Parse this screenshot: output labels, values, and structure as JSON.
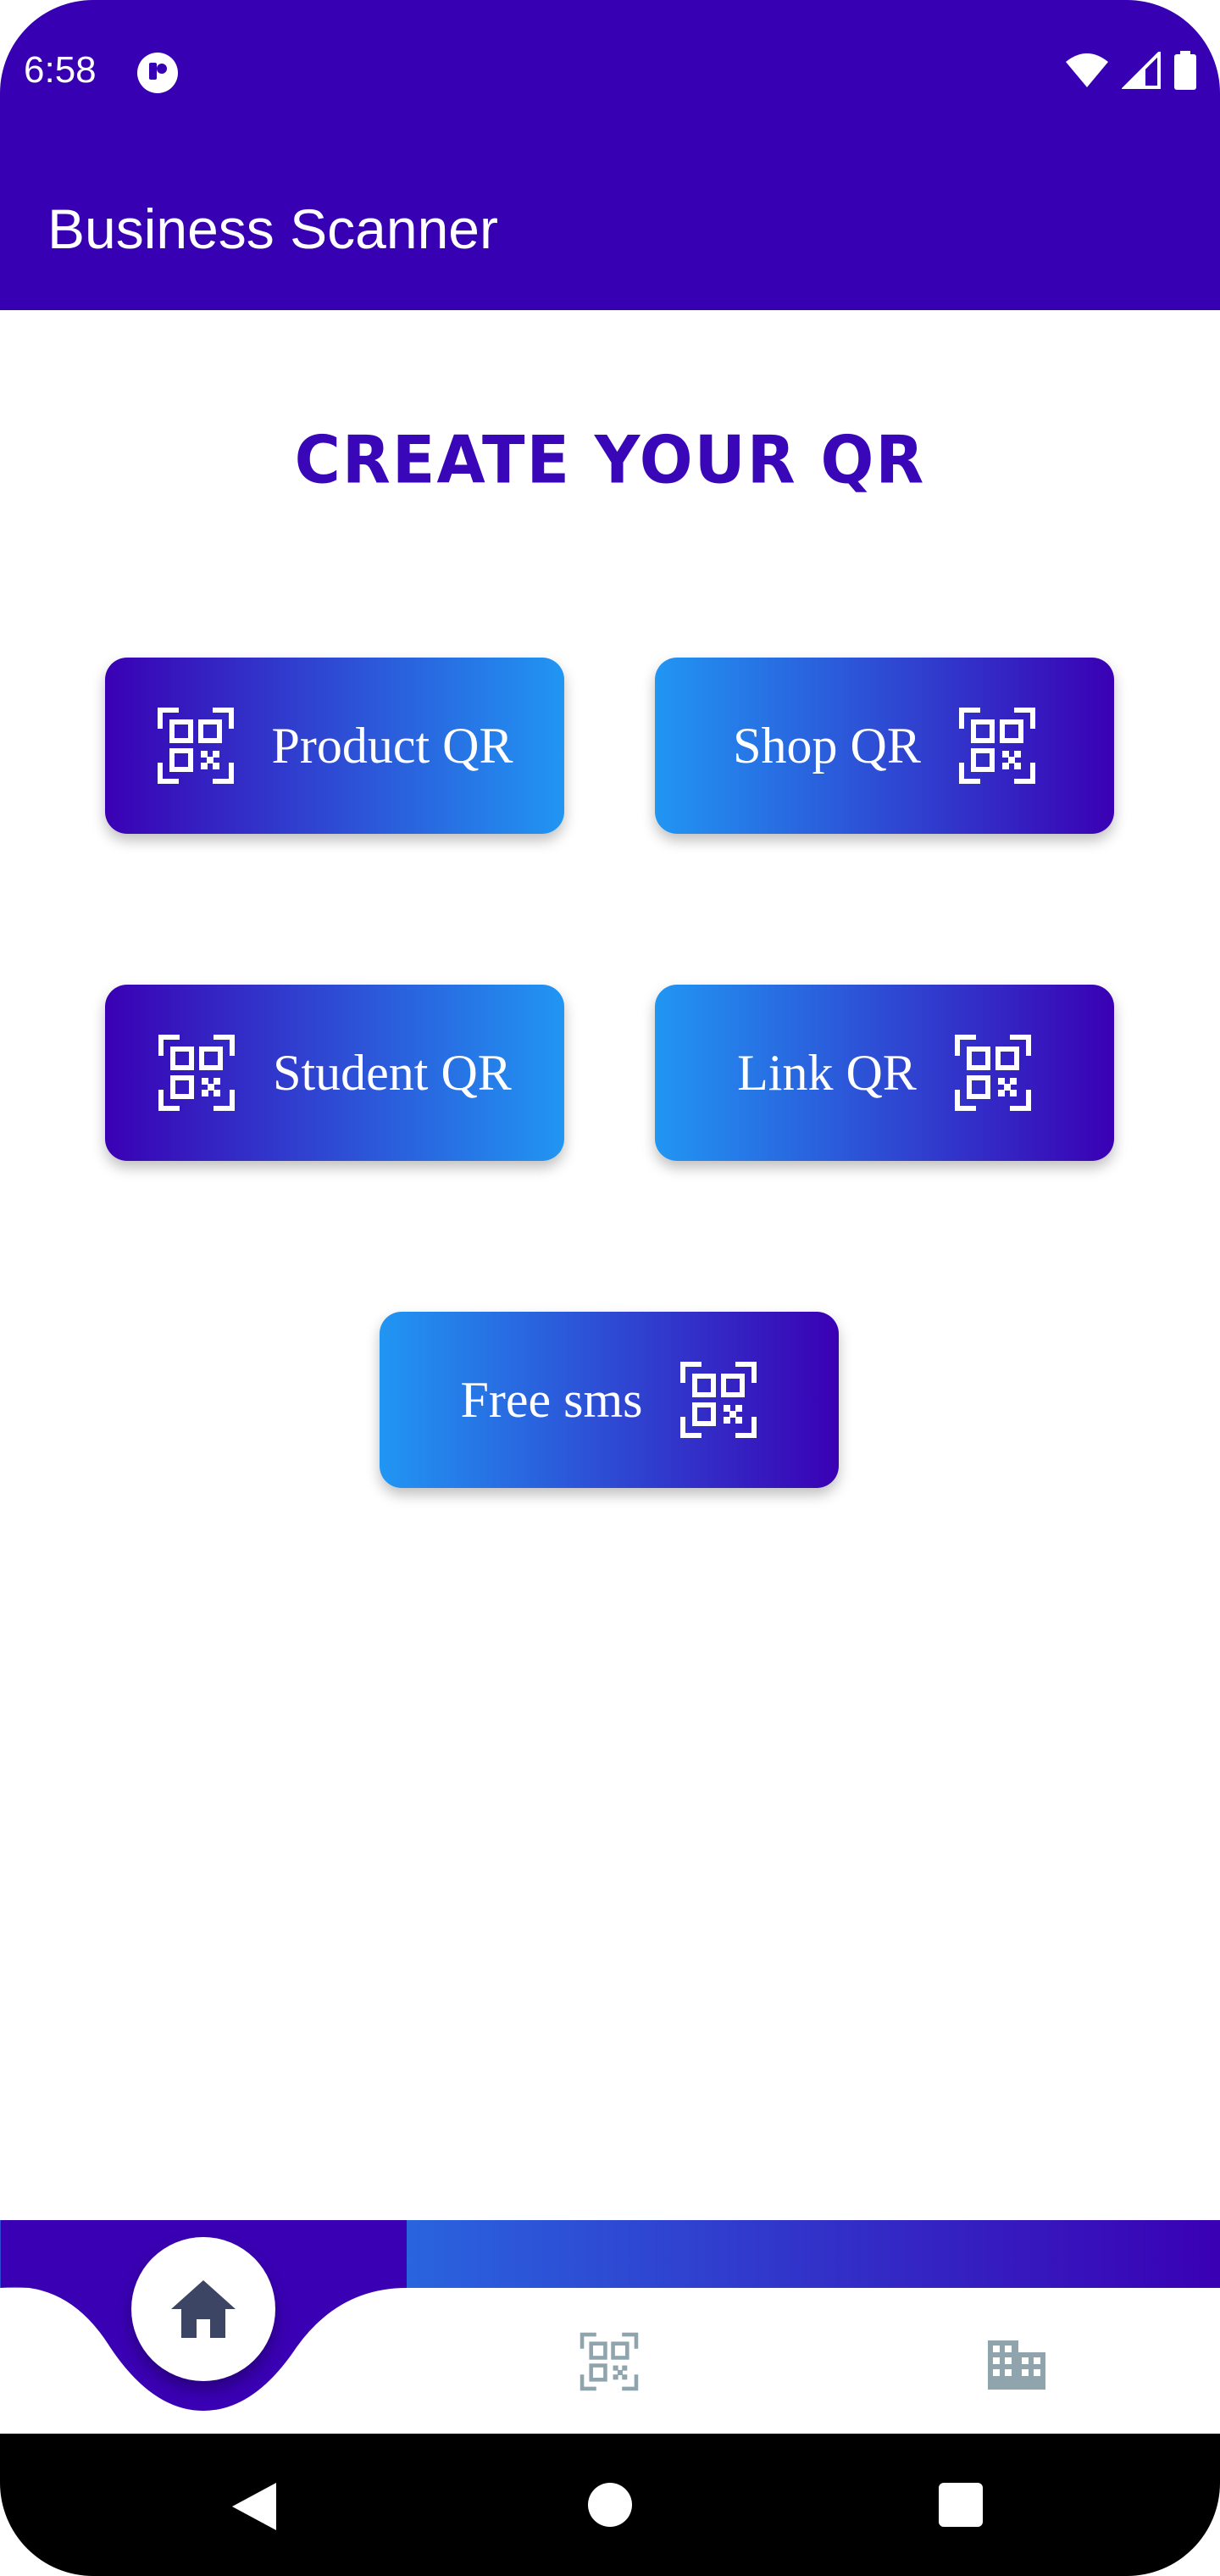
{
  "status_bar": {
    "time": "6:58"
  },
  "app_bar": {
    "title": "Business Scanner"
  },
  "main": {
    "heading": "CREATE YOUR QR",
    "buttons": [
      {
        "label": "Product QR",
        "icon": "qr-code-icon"
      },
      {
        "label": "Shop QR",
        "icon": "qr-code-icon"
      },
      {
        "label": "Student QR",
        "icon": "qr-code-icon"
      },
      {
        "label": "Link QR",
        "icon": "qr-code-icon"
      },
      {
        "label": "Free sms",
        "icon": "qr-code-icon"
      }
    ]
  },
  "bottom_nav": {
    "items": [
      {
        "icon": "home-icon",
        "active": true
      },
      {
        "icon": "qr-code-icon",
        "active": false
      },
      {
        "icon": "building-icon",
        "active": false
      }
    ]
  },
  "colors": {
    "primary": "#3700b3",
    "gradient_light": "#2196f3",
    "gradient_dark": "#3a00b4",
    "heading": "#3a07b8",
    "inactive_icon": "#90a4ae"
  }
}
